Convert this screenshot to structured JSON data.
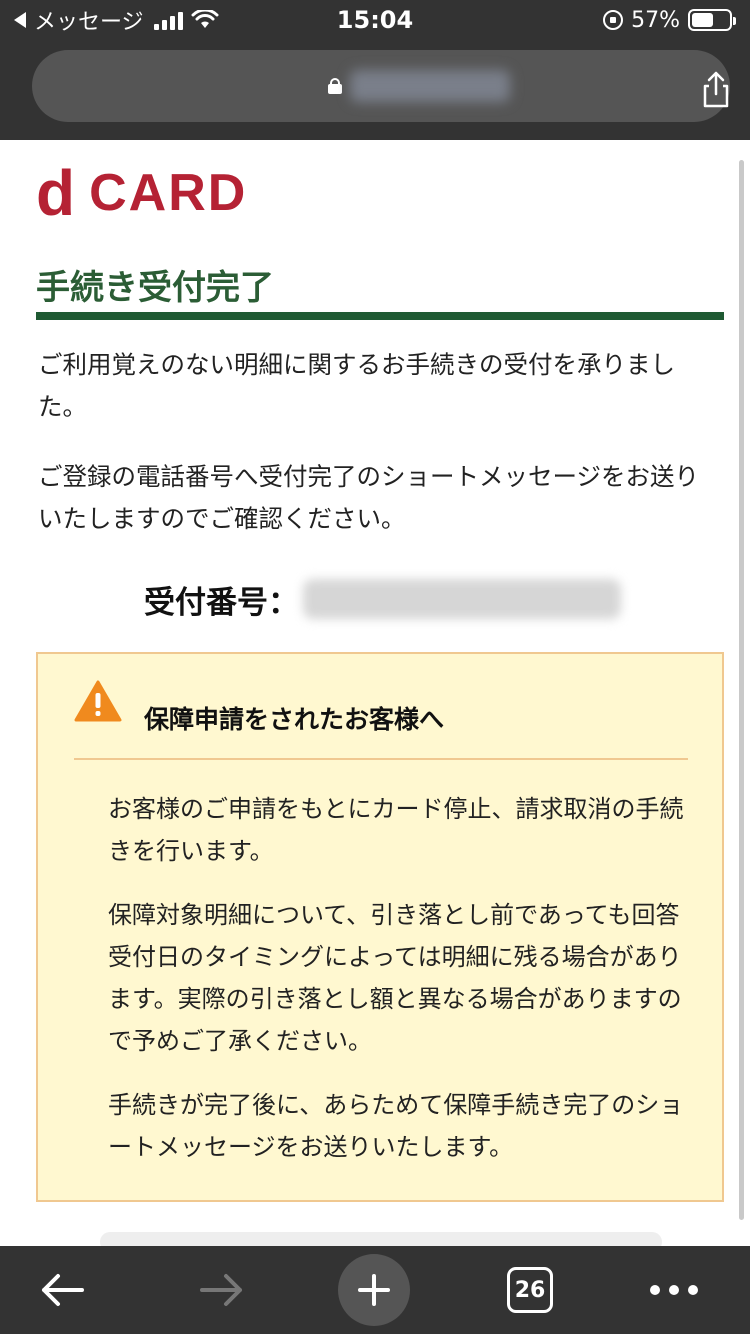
{
  "status_bar": {
    "back_app": "メッセージ",
    "time": "15:04",
    "battery_percent": "57%",
    "battery_level": 0.57
  },
  "url_bar": {
    "url": "",
    "url_blurred": true
  },
  "logo": {
    "d": "d",
    "card": "CARD",
    "color": "#b52234"
  },
  "page": {
    "heading": "手続き受付完了",
    "para1": "ご利用覚えのない明細に関するお手続きの受付を承りました。",
    "para2": "ご登録の電話番号へ受付完了のショートメッセージをお送りいたしますのでご確認ください。",
    "receipt_label": "受付番号：",
    "receipt_number": "",
    "receipt_blurred": true
  },
  "notice": {
    "icon": "warning-icon",
    "title": "保障申請をされたお客様へ",
    "p1": "お客様のご申請をもとにカード停止、請求取消の手続きを行います。",
    "p2": "保障対象明細について、引き落とし前であっても回答受付日のタイミングによっては明細に残る場合があります。実際の引き落とし額と異なる場合がありますので予めご了承ください。",
    "p3": "手続きが完了後に、あらためて保障手続き完了のショートメッセージをお送りいたします。"
  },
  "toolbar": {
    "tab_count": "26",
    "icons": [
      "back-arrow-icon",
      "forward-arrow-icon",
      "plus-icon",
      "tabs-icon",
      "more-icon"
    ]
  },
  "colors": {
    "accent_green": "#1f5a33",
    "notice_bg": "#fff8d0",
    "notice_border": "#f0c890",
    "chrome_bg": "#333333"
  }
}
